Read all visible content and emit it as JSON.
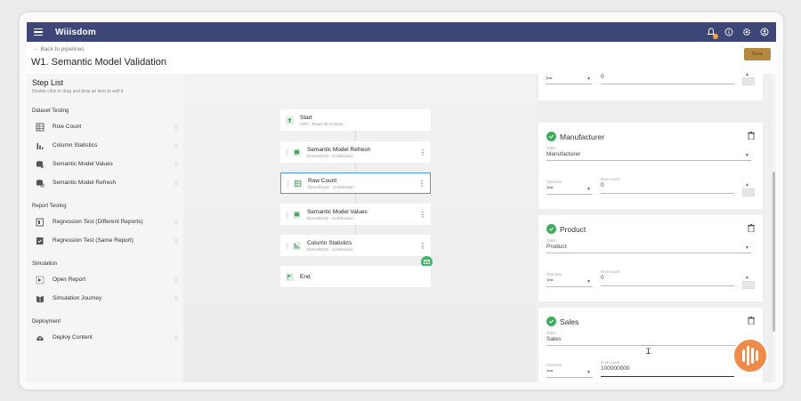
{
  "app": {
    "brand": "Wiiisdom"
  },
  "header": {
    "back": "Back to pipelines",
    "title": "W1. Semantic Model Validation",
    "save": "Save"
  },
  "steplist": {
    "title": "Step List",
    "subtitle": "Double click or drag and drop an item to add it",
    "sections": [
      {
        "name": "Dataset Testing",
        "items": [
          "Row Count",
          "Column Statistics",
          "Semantic Model Values",
          "Semantic Model Refresh"
        ]
      },
      {
        "name": "Report Testing",
        "items": [
          "Regression Test (Different Reports)",
          "Regression Test (Same Report)"
        ]
      },
      {
        "name": "Simulation",
        "items": [
          "Open Report",
          "Simulation Journey"
        ]
      },
      {
        "name": "Deployment",
        "items": [
          "Deploy Content"
        ]
      }
    ]
  },
  "pipeline": {
    "start": {
      "title": "Start",
      "sub": "CPD - Power BI Context"
    },
    "nodes": [
      {
        "title": "Semantic Model Refresh",
        "sub": "Demo/DIAD - Certification"
      },
      {
        "title": "Row Count",
        "sub": "Demo/DIAD - Certification"
      },
      {
        "title": "Semantic Model Values",
        "sub": "Demo/DIAD - Certification"
      },
      {
        "title": "Column Statistics",
        "sub": "Demo/DIAD - Certification"
      }
    ],
    "end": {
      "title": "End"
    }
  },
  "config": {
    "top_partial": {
      "operator": ">=",
      "row_count": "0"
    },
    "table_label": "Table",
    "operator_label": "Operator",
    "rowcount_label": "Row count",
    "cards": [
      {
        "title": "Manufacturer",
        "table": "Manufacturer",
        "operator": ">=",
        "row_count": "0"
      },
      {
        "title": "Product",
        "table": "Product",
        "operator": ">=",
        "row_count": "0"
      },
      {
        "title": "Sales",
        "table": "Sales",
        "operator": "==",
        "row_count": "100000000"
      }
    ]
  },
  "colors": {
    "topbar": "#3d4676",
    "accent": "#3eae5e",
    "save": "#b5893f",
    "selected": "#4b9be0"
  }
}
